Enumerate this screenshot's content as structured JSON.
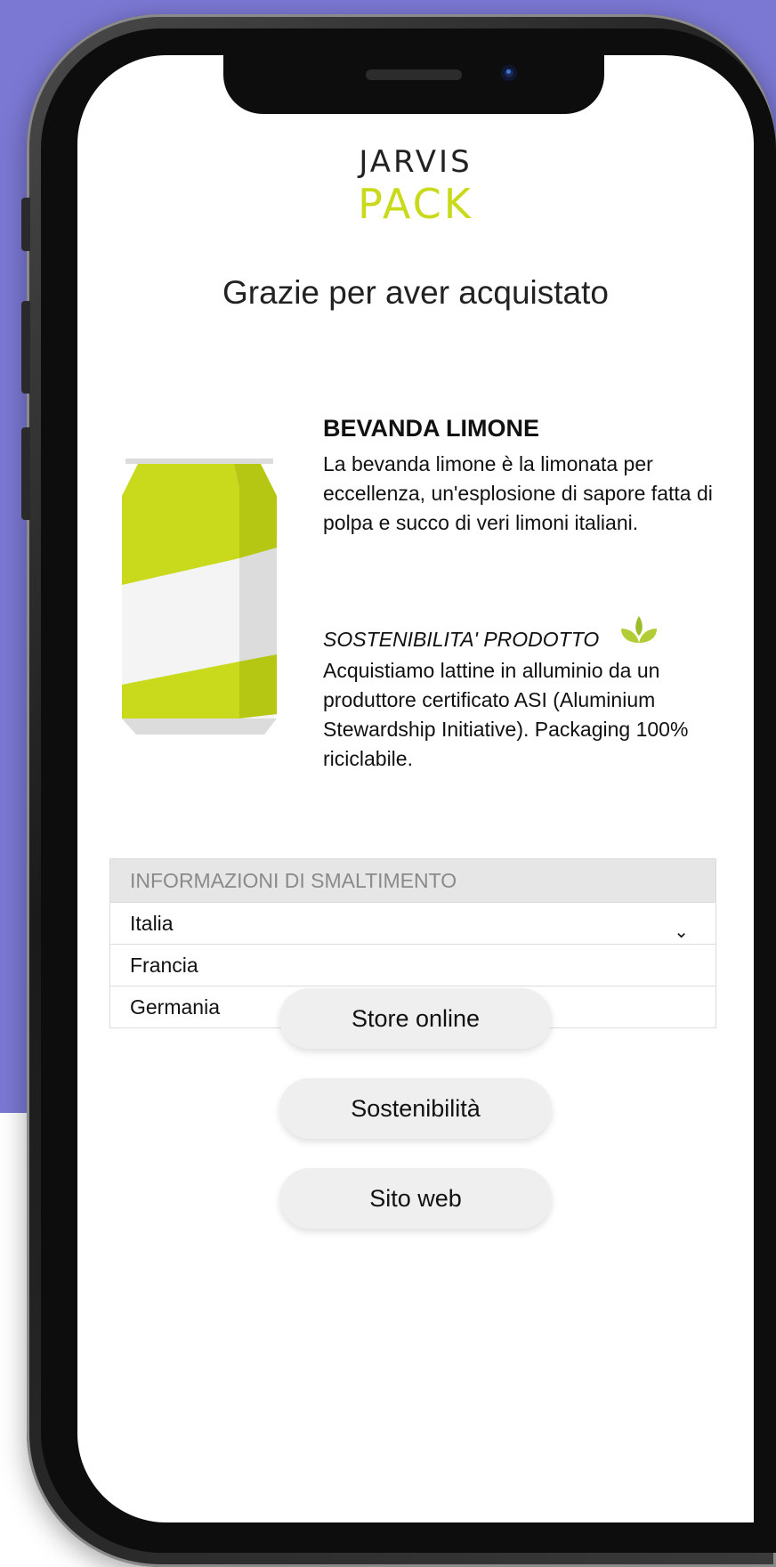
{
  "brand": {
    "logo_top": "JARVIS",
    "logo_bottom": "PACK",
    "logo_accent_color": "#c9da1c"
  },
  "header": {
    "title": "Grazie per aver acquistato"
  },
  "product": {
    "name": "BEVANDA LIMONE",
    "description": "La bevanda limone è la limonata per eccellenza, un'esplosione di sapore fatta di polpa e succo di veri limoni italiani.",
    "image_icon": "lemon-soda-can-icon",
    "can_colors": {
      "primary": "#c9da1c",
      "shade": "#b5c712",
      "light": "#f4f4f4",
      "lid": "#dcdcdc"
    }
  },
  "sustainability": {
    "title": "SOSTENIBILITA' PRODOTTO",
    "icon": "leaf-icon",
    "icon_color": "#b2cc35",
    "description": "Acquistiamo lattine in alluminio da un produttore certificato ASI (Aluminium Stewardship Initiative). Packaging 100% riciclabile."
  },
  "disposal": {
    "header": "INFORMAZIONI DI SMALTIMENTO",
    "options": [
      "Italia",
      "Francia",
      "Germania"
    ],
    "expand_icon": "chevron-down-icon"
  },
  "buttons": {
    "store": "Store online",
    "sustainability": "Sostenibilità",
    "website": "Sito web"
  },
  "colors": {
    "background": "#7b78d4",
    "button_bg": "#efefef"
  }
}
